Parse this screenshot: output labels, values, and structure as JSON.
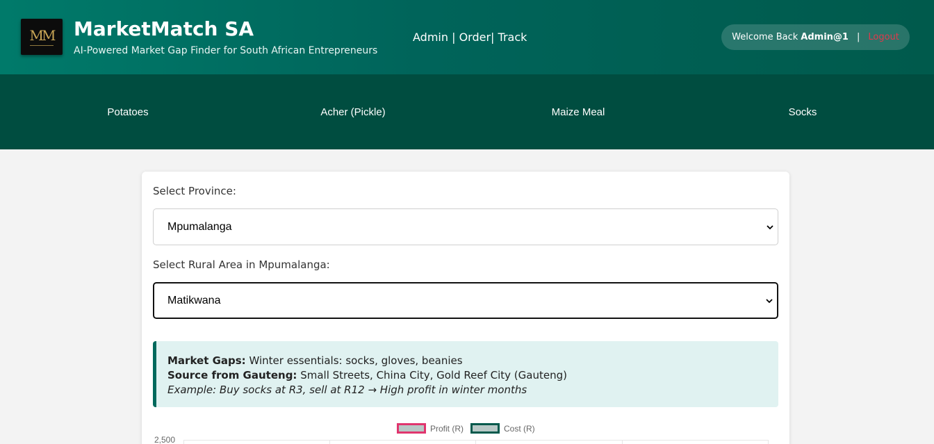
{
  "header": {
    "logo_text": "MM",
    "title": "MarketMatch SA",
    "subtitle": "AI-Powered Market Gap Finder for South African Entrepreneurs",
    "nav": [
      "Admin",
      "Order",
      "Track"
    ],
    "welcome_prefix": "Welcome Back",
    "username": "Admin@1",
    "separator": "|",
    "logout_label": "Logout"
  },
  "categories": [
    "Potatoes",
    "Acher (Pickle)",
    "Maize Meal",
    "Socks"
  ],
  "form": {
    "province_label": "Select Province:",
    "province_value": "Mpumalanga",
    "area_label": "Select Rural Area in Mpumalanga:",
    "area_value": "Matikwana"
  },
  "info": {
    "gaps_label": "Market Gaps:",
    "gaps_value": "Winter essentials: socks, gloves, beanies",
    "source_label": "Source from Gauteng:",
    "source_value": "Small Streets, China City, Gold Reef City (Gauteng)",
    "example": "Example: Buy socks at R3, sell at R12 → High profit in winter months"
  },
  "chart_data": {
    "type": "bar",
    "series": [
      {
        "name": "Profit (R)",
        "color": "#e0356e"
      },
      {
        "name": "Cost (R)",
        "color": "#00594c"
      }
    ],
    "y_tick_visible": "2,500"
  },
  "colors": {
    "header_primary": "#00695c",
    "nav_bg": "#004d40",
    "logout": "#e0394b",
    "info_bg": "#e0f2f1"
  }
}
